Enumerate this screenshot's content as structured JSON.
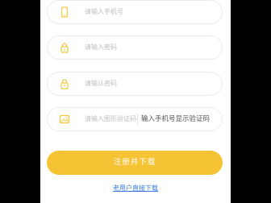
{
  "form": {
    "phone": {
      "placeholder": "请输入手机号",
      "icon": "phone-icon"
    },
    "password": {
      "placeholder": "请输入密码",
      "icon": "lock-icon"
    },
    "confirm_password": {
      "placeholder": "请输认密码",
      "icon": "lock-icon"
    },
    "captcha": {
      "placeholder": "请输入图形验证码",
      "icon": "image-icon",
      "button_label": "输入手机号显示验证码"
    }
  },
  "actions": {
    "submit_label": "注册并下载",
    "direct_download_label": "老用户直接下载"
  },
  "colors": {
    "accent": "#f6c334",
    "icon": "#f3c640",
    "link": "#3a7be0",
    "background": "#000000"
  }
}
